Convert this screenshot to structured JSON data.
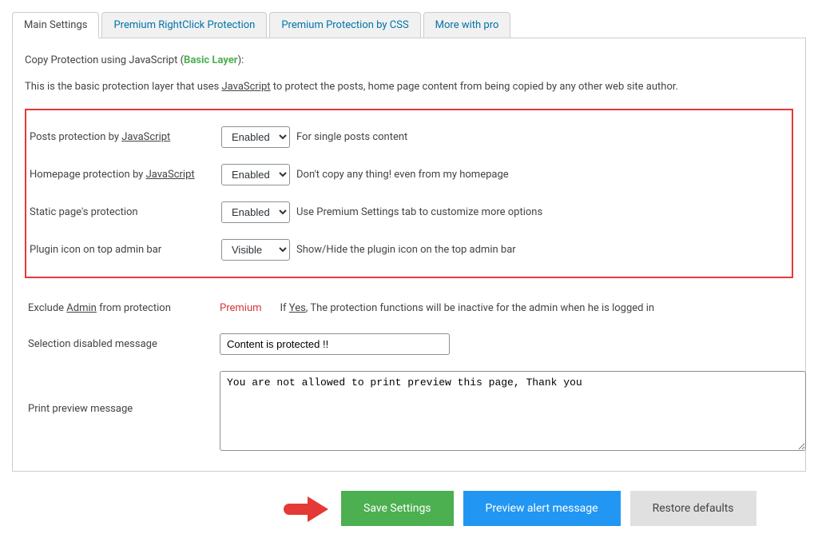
{
  "tabs": {
    "main": "Main Settings",
    "rightclick": "Premium RightClick Protection",
    "css": "Premium Protection by CSS",
    "more": "More with pro"
  },
  "section": {
    "title_prefix": "Copy Protection using JavaScript (",
    "title_layer": "Basic Layer",
    "title_suffix": "):",
    "desc_before": "This is the basic protection layer that uses ",
    "desc_js": "JavaScript",
    "desc_after": " to protect the posts, home page content from being copied by any other web site author."
  },
  "rows": {
    "posts": {
      "label_before": "Posts protection by ",
      "label_link": "JavaScript",
      "value": "Enabled",
      "hint": "For single posts content"
    },
    "homepage": {
      "label_before": "Homepage protection by ",
      "label_link": "JavaScript",
      "value": "Enabled",
      "hint": "Don't copy any thing! even from my homepage"
    },
    "static": {
      "label": "Static page's protection",
      "value": "Enabled",
      "hint": "Use Premium Settings tab to customize more options"
    },
    "icon": {
      "label": "Plugin icon on top admin bar",
      "value": "Visible",
      "hint": "Show/Hide the plugin icon on the top admin bar"
    },
    "exclude": {
      "label_before": "Exclude ",
      "label_link": "Admin",
      "label_after": " from protection",
      "premium": "Premium",
      "hint_before": "If ",
      "hint_yes": "Yes",
      "hint_after": ", The protection functions will be inactive for the admin when he is logged in"
    },
    "selmsg": {
      "label": "Selection disabled message",
      "value": "Content is protected !!"
    },
    "printmsg": {
      "label": "Print preview message",
      "value": "You are not allowed to print preview this page, Thank you"
    }
  },
  "buttons": {
    "save": "Save Settings",
    "preview": "Preview alert message",
    "restore": "Restore defaults"
  }
}
